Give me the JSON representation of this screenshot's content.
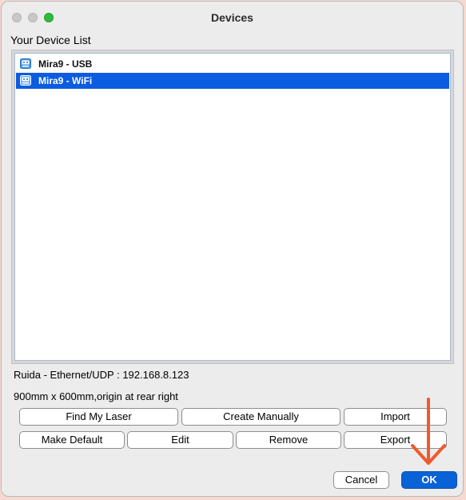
{
  "window": {
    "title": "Devices"
  },
  "device_list": {
    "label": "Your Device List",
    "items": [
      {
        "label": "Mira9 - USB",
        "icon": "laser-device-icon",
        "selected": false
      },
      {
        "label": "Mira9 - WiFi",
        "icon": "laser-device-icon",
        "selected": true
      }
    ]
  },
  "details": {
    "connection": "Ruida - Ethernet/UDP : 192.168.8.123",
    "dimensions": "900mm x 600mm,origin at rear right"
  },
  "actions": {
    "find_my_laser": "Find My Laser",
    "create_manually": "Create Manually",
    "import": "Import",
    "make_default": "Make Default",
    "edit": "Edit",
    "remove": "Remove",
    "export": "Export"
  },
  "footer": {
    "cancel": "Cancel",
    "ok": "OK"
  },
  "colors": {
    "selection": "#0b5ce0",
    "ok_button": "#0a63d6",
    "annotation_arrow": "#f05a2c"
  }
}
